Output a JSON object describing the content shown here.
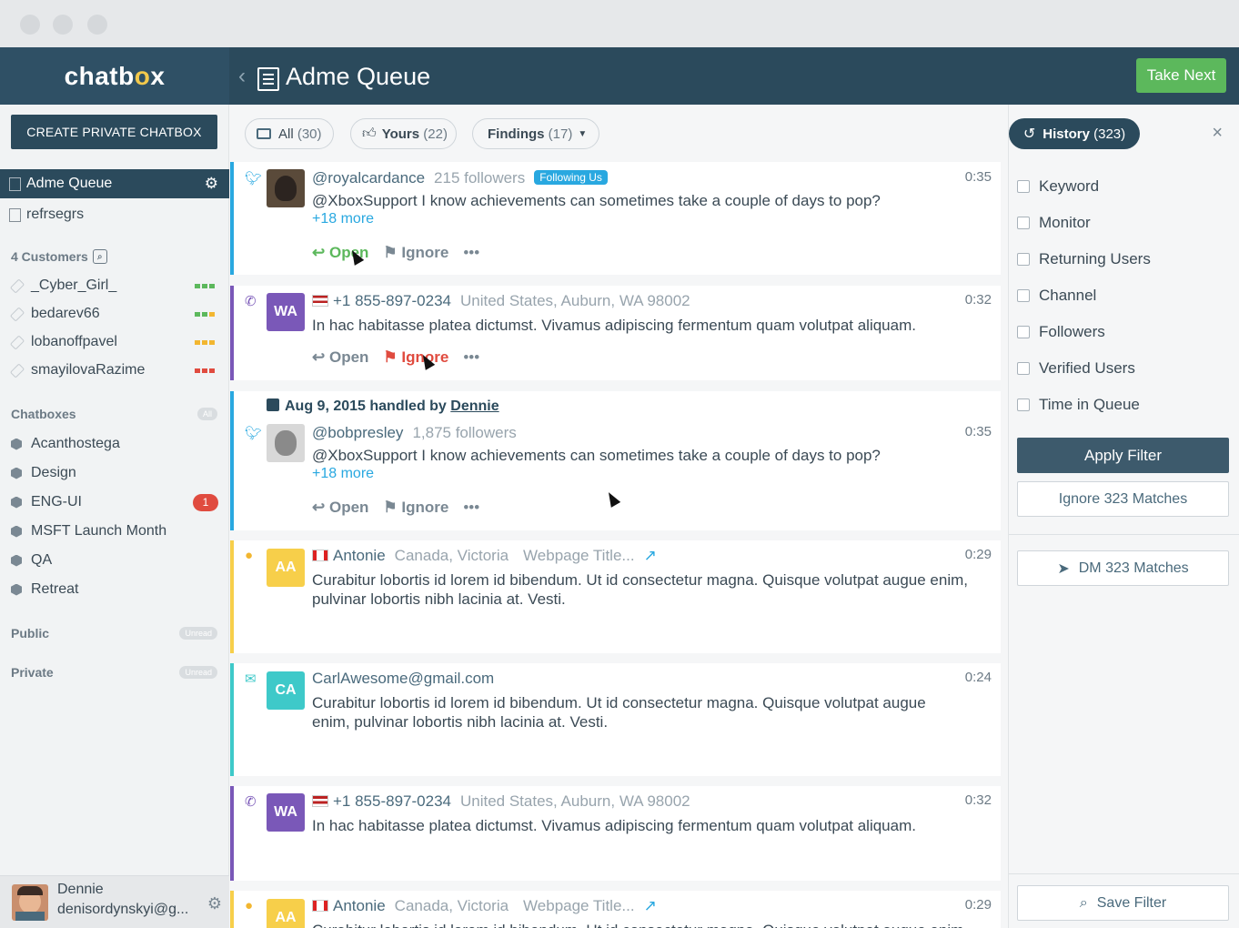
{
  "app": {
    "logo": "chatb",
    "logo_accent": "o",
    "logo_end": "x",
    "title": "Adme Queue",
    "take_next": "Take Next"
  },
  "sidebar": {
    "create_label": "CREATE PRIVATE CHATBOX",
    "queues": [
      {
        "label": "Adme Queue"
      },
      {
        "label": "refrsegrs"
      }
    ],
    "customers_head": "4 Customers",
    "customers": [
      {
        "label": "_Cyber_Girl_",
        "color": "#5cb85c"
      },
      {
        "label": "bedarev66",
        "color": "#5cb85c",
        "color2": "#f2b630"
      },
      {
        "label": "lobanoffpavel",
        "color": "#f2b630"
      },
      {
        "label": "smayilovaRazime",
        "color": "#e04b3f"
      }
    ],
    "chatboxes_head": "Chatboxes",
    "chatboxes_pill": "All",
    "chatboxes": [
      {
        "label": "Acanthostega"
      },
      {
        "label": "Design"
      },
      {
        "label": "ENG-UI",
        "badge": "1"
      },
      {
        "label": "MSFT Launch Month"
      },
      {
        "label": "QA"
      },
      {
        "label": "Retreat"
      }
    ],
    "public_head": "Public",
    "public_pill": "Unread",
    "private_head": "Private",
    "private_pill": "Unread",
    "user_name": "Dennie",
    "user_email": "denisordynskyi@g..."
  },
  "filters": {
    "all": "All",
    "all_count": "(30)",
    "yours": "Yours",
    "yours_count": "(22)",
    "findings": "Findings",
    "findings_count": "(17)"
  },
  "feed": [
    {
      "channel": "twitter",
      "handle": "@royalcardance",
      "meta": "215 followers",
      "badge": "Following Us",
      "time": "0:35",
      "text": "@XboxSupport I know achievements can sometimes take a couple of days to pop?",
      "more": "+18 more",
      "open": "Open",
      "ignore": "Ignore",
      "dots": "•••"
    },
    {
      "channel": "phone",
      "initials": "WA",
      "handle": "+1 855-897-0234",
      "meta": "United States, Auburn, WA 98002",
      "time": "0:32",
      "text": "In hac habitasse platea dictumst. Vivamus adipiscing fermentum quam volutpat aliquam.",
      "open": "Open",
      "ignore": "Ignore",
      "dots": "•••"
    },
    {
      "channel": "twitter",
      "handled_date": "Aug 9, 2015 handled by",
      "handled_by": "Dennie",
      "handle": "@bobpresley",
      "meta": "1,875 followers",
      "time": "0:35",
      "text": "@XboxSupport I know achievements can sometimes take a couple of days to pop?",
      "more": "+18 more",
      "open": "Open",
      "ignore": "Ignore",
      "dots": "•••"
    },
    {
      "channel": "web",
      "initials": "AA",
      "handle": "Antonie",
      "meta": "Canada, Victoria",
      "page": "Webpage Title...",
      "time": "0:29",
      "text": "Curabitur lobortis id lorem id bibendum. Ut id consectetur magna. Quisque volutpat augue enim, pulvinar lobortis nibh lacinia at. Vesti."
    },
    {
      "channel": "email",
      "initials": "CA",
      "handle": "CarlAwesome@gmail.com",
      "time": "0:24",
      "text": "Curabitur lobortis id lorem id bibendum. Ut id consectetur magna. Quisque volutpat augue enim, pulvinar lobortis nibh lacinia at. Vesti."
    },
    {
      "channel": "phone",
      "initials": "WA",
      "handle": "+1 855-897-0234",
      "meta": "United States, Auburn, WA 98002",
      "time": "0:32",
      "text": "In hac habitasse platea dictumst. Vivamus adipiscing fermentum quam volutpat aliquam."
    },
    {
      "channel": "web",
      "initials": "AA",
      "handle": "Antonie",
      "meta": "Canada, Victoria",
      "page": "Webpage Title...",
      "time": "0:29",
      "text": "Curabitur lobortis id lorem id bibendum. Ut id consectetur magna. Quisque volutpat augue enim, pulvinar lobortis nibh lacinia at. Vesti."
    }
  ],
  "panel": {
    "history": "History",
    "history_count": "(323)",
    "close": "×",
    "checks": [
      "Keyword",
      "Monitor",
      "Returning Users",
      "Channel",
      "Followers",
      "Verified Users",
      "Time in Queue"
    ],
    "apply": "Apply Filter",
    "ignore_matches": "Ignore 323 Matches",
    "dm_matches": "DM 323 Matches",
    "save_filter": "Save Filter"
  },
  "colors": {
    "navy": "#2b4a5c",
    "green": "#5cb85c",
    "twitter": "#29a8e0",
    "purple": "#7a58b8",
    "yellow": "#f7cf4a",
    "teal": "#3ec9c9",
    "red": "#e04b3f"
  }
}
